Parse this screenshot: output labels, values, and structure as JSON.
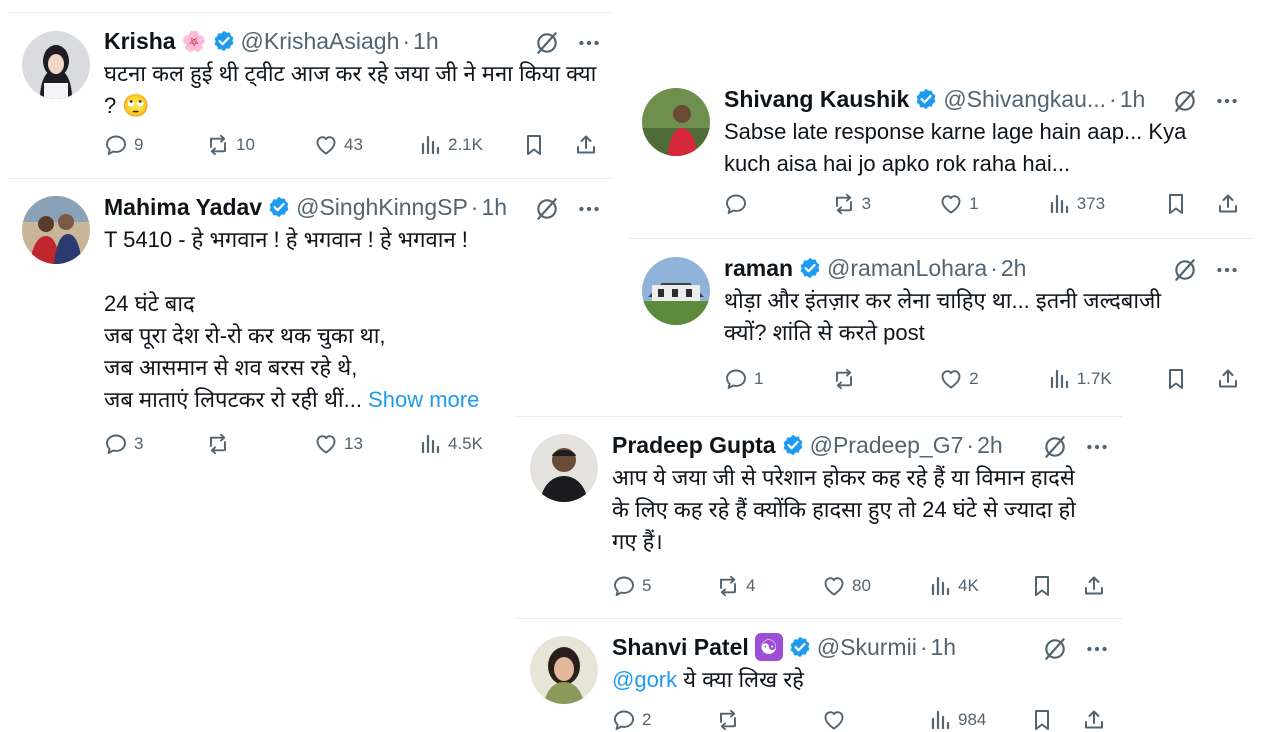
{
  "tweets": [
    {
      "name": "Krisha",
      "emoji": "🌸",
      "handle": "@KrishaAsiagh",
      "sep": "·",
      "time": "1h",
      "text": "घटना कल हुई थी ट्वीट आज कर रहे जया जी ने मना किया क्या\n? 🙄",
      "replies": "9",
      "reposts": "10",
      "likes": "43",
      "views": "2.1K"
    },
    {
      "name": "Mahima Yadav",
      "handle": "@SinghKinngSP",
      "sep": "·",
      "time": "1h",
      "text": "T 5410 - हे भगवान ! हे भगवान ! हे भगवान !\n\n24 घंटे बाद\nजब पूरा देश रो-रो कर थक चुका था,\nजब आसमान से शव बरस रहे थे,\nजब माताएं लिपटकर रो रही थीं... ",
      "show_more": "Show more",
      "replies": "3",
      "reposts": "",
      "likes": "13",
      "views": "4.5K"
    },
    {
      "name": "Shivang Kaushik",
      "handle": "@Shivangkau...",
      "sep": "·",
      "time": "1h",
      "text": "Sabse late response karne lage hain aap... Kya\nkuch aisa hai jo apko rok raha hai...",
      "replies": "",
      "reposts": "3",
      "likes": "1",
      "views": "373"
    },
    {
      "name": "raman",
      "handle": "@ramanLohara",
      "sep": "·",
      "time": "2h",
      "text": "थोड़ा और इंतज़ार कर लेना चाहिए था... इतनी जल्दबाजी\nक्यों? शांति से करते post",
      "replies": "1",
      "reposts": "",
      "likes": "2",
      "views": "1.7K"
    },
    {
      "name": "Pradeep Gupta",
      "handle": "@Pradeep_G7",
      "sep": "·",
      "time": "2h",
      "text": "आप ये जया जी से परेशान होकर कह रहे हैं या विमान हादसे\nके लिए कह रहे हैं क्योंकि हादसा हुए तो 24 घंटे से ज्यादा हो\nगए हैं।",
      "replies": "5",
      "reposts": "4",
      "likes": "80",
      "views": "4K"
    },
    {
      "name": "Shanvi Patel",
      "emoji": "☯️",
      "handle": "@Skurmii",
      "sep": "·",
      "time": "1h",
      "mention": "@gork",
      "text": " ये क्या लिख रहे",
      "replies": "2",
      "reposts": "",
      "likes": "",
      "views": "984"
    }
  ],
  "icons": {
    "verified": "verified-badge-icon",
    "grok": "grok-icon",
    "more": "more-dots-icon",
    "reply": "reply-bubble-icon",
    "repost": "repost-arrows-icon",
    "like": "heart-icon",
    "views": "views-bars-icon",
    "bookmark": "bookmark-icon",
    "share": "share-upload-icon"
  },
  "colors": {
    "text": "#0f1419",
    "muted": "#536471",
    "link": "#1d9bf0",
    "verified": "#1d9bf0",
    "divider": "#eaedf0"
  }
}
